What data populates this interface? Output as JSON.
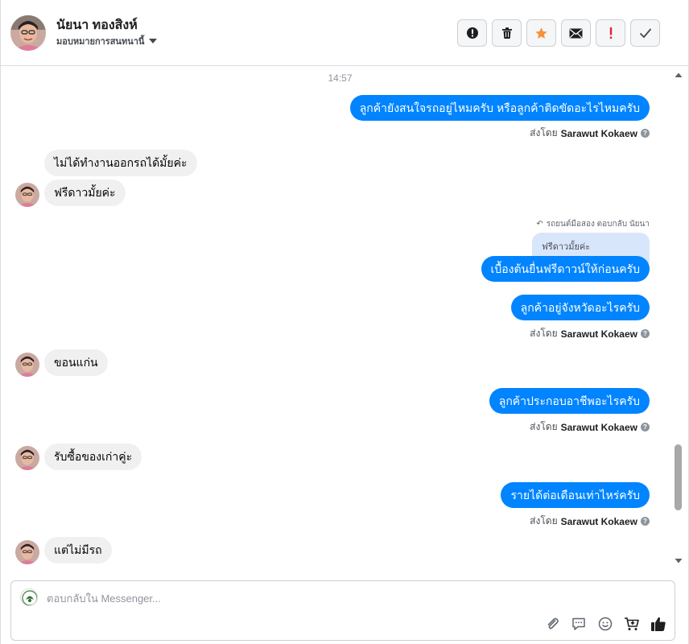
{
  "header": {
    "contact_name": "นัยนา ทองสิงห์",
    "assign_label": "มอบหมายการสนทนานี้",
    "actions": [
      {
        "name": "spam-button",
        "icon": "alert-circle-icon"
      },
      {
        "name": "delete-button",
        "icon": "trash-icon"
      },
      {
        "name": "star-button",
        "icon": "star-icon"
      },
      {
        "name": "mark-unread-button",
        "icon": "envelope-icon"
      },
      {
        "name": "follow-up-button",
        "icon": "exclamation-icon"
      },
      {
        "name": "mark-done-button",
        "icon": "check-icon"
      }
    ]
  },
  "chat": {
    "timestamp": "14:57",
    "messages": [
      {
        "dir": "out",
        "text": "ลูกค้ายังสนใจรถอยู่ไหมครับ หรือลูกค้าติดขัดอะไรไหมครับ"
      },
      {
        "dir": "out-meta",
        "prefix": "ส่งโดย",
        "sender": "Sarawut Kokaew"
      },
      {
        "dir": "in",
        "text": "ไม่ได้ทำงานออกรถได้มั้ยค่ะ"
      },
      {
        "dir": "in",
        "text": "ฟรีดาวมั้ยค่ะ"
      },
      {
        "dir": "reply-note",
        "text": "รถยนต์มือสอง ตอบกลับ นัยนา"
      },
      {
        "dir": "quoted",
        "text": "ฟรีดาวมั้ยค่ะ"
      },
      {
        "dir": "out",
        "text": "เบื้องต้นยื่นฟรีดาวน์ให้ก่อนครับ"
      },
      {
        "dir": "out",
        "text": "ลูกค้าอยู่จังหวัดอะไรครับ"
      },
      {
        "dir": "out-meta",
        "prefix": "ส่งโดย",
        "sender": "Sarawut Kokaew"
      },
      {
        "dir": "in",
        "text": "ขอนแก่น"
      },
      {
        "dir": "out",
        "text": "ลูกค้าประกอบอาชีพอะไรครับ"
      },
      {
        "dir": "out-meta",
        "prefix": "ส่งโดย",
        "sender": "Sarawut Kokaew"
      },
      {
        "dir": "in",
        "text": "รับซื้อของเก่าคู่ะ"
      },
      {
        "dir": "out",
        "text": "รายได้ต่อเดือนเท่าไหร่ครับ"
      },
      {
        "dir": "out-meta",
        "prefix": "ส่งโดย",
        "sender": "Sarawut Kokaew"
      },
      {
        "dir": "in",
        "text": "แต่ไม่มีรถ"
      }
    ]
  },
  "composer": {
    "placeholder": "ตอบกลับใน Messenger...",
    "tools": [
      "paperclip-icon",
      "saved-replies-icon",
      "emoji-icon",
      "cart-icon",
      "thumbs-up-icon"
    ]
  },
  "colors": {
    "outgoing_bubble": "#0084ff",
    "incoming_bubble": "#f0f0f0",
    "quoted_bubble": "#d8e6fb",
    "star": "#f7923a",
    "exclamation": "#e41e3f"
  }
}
